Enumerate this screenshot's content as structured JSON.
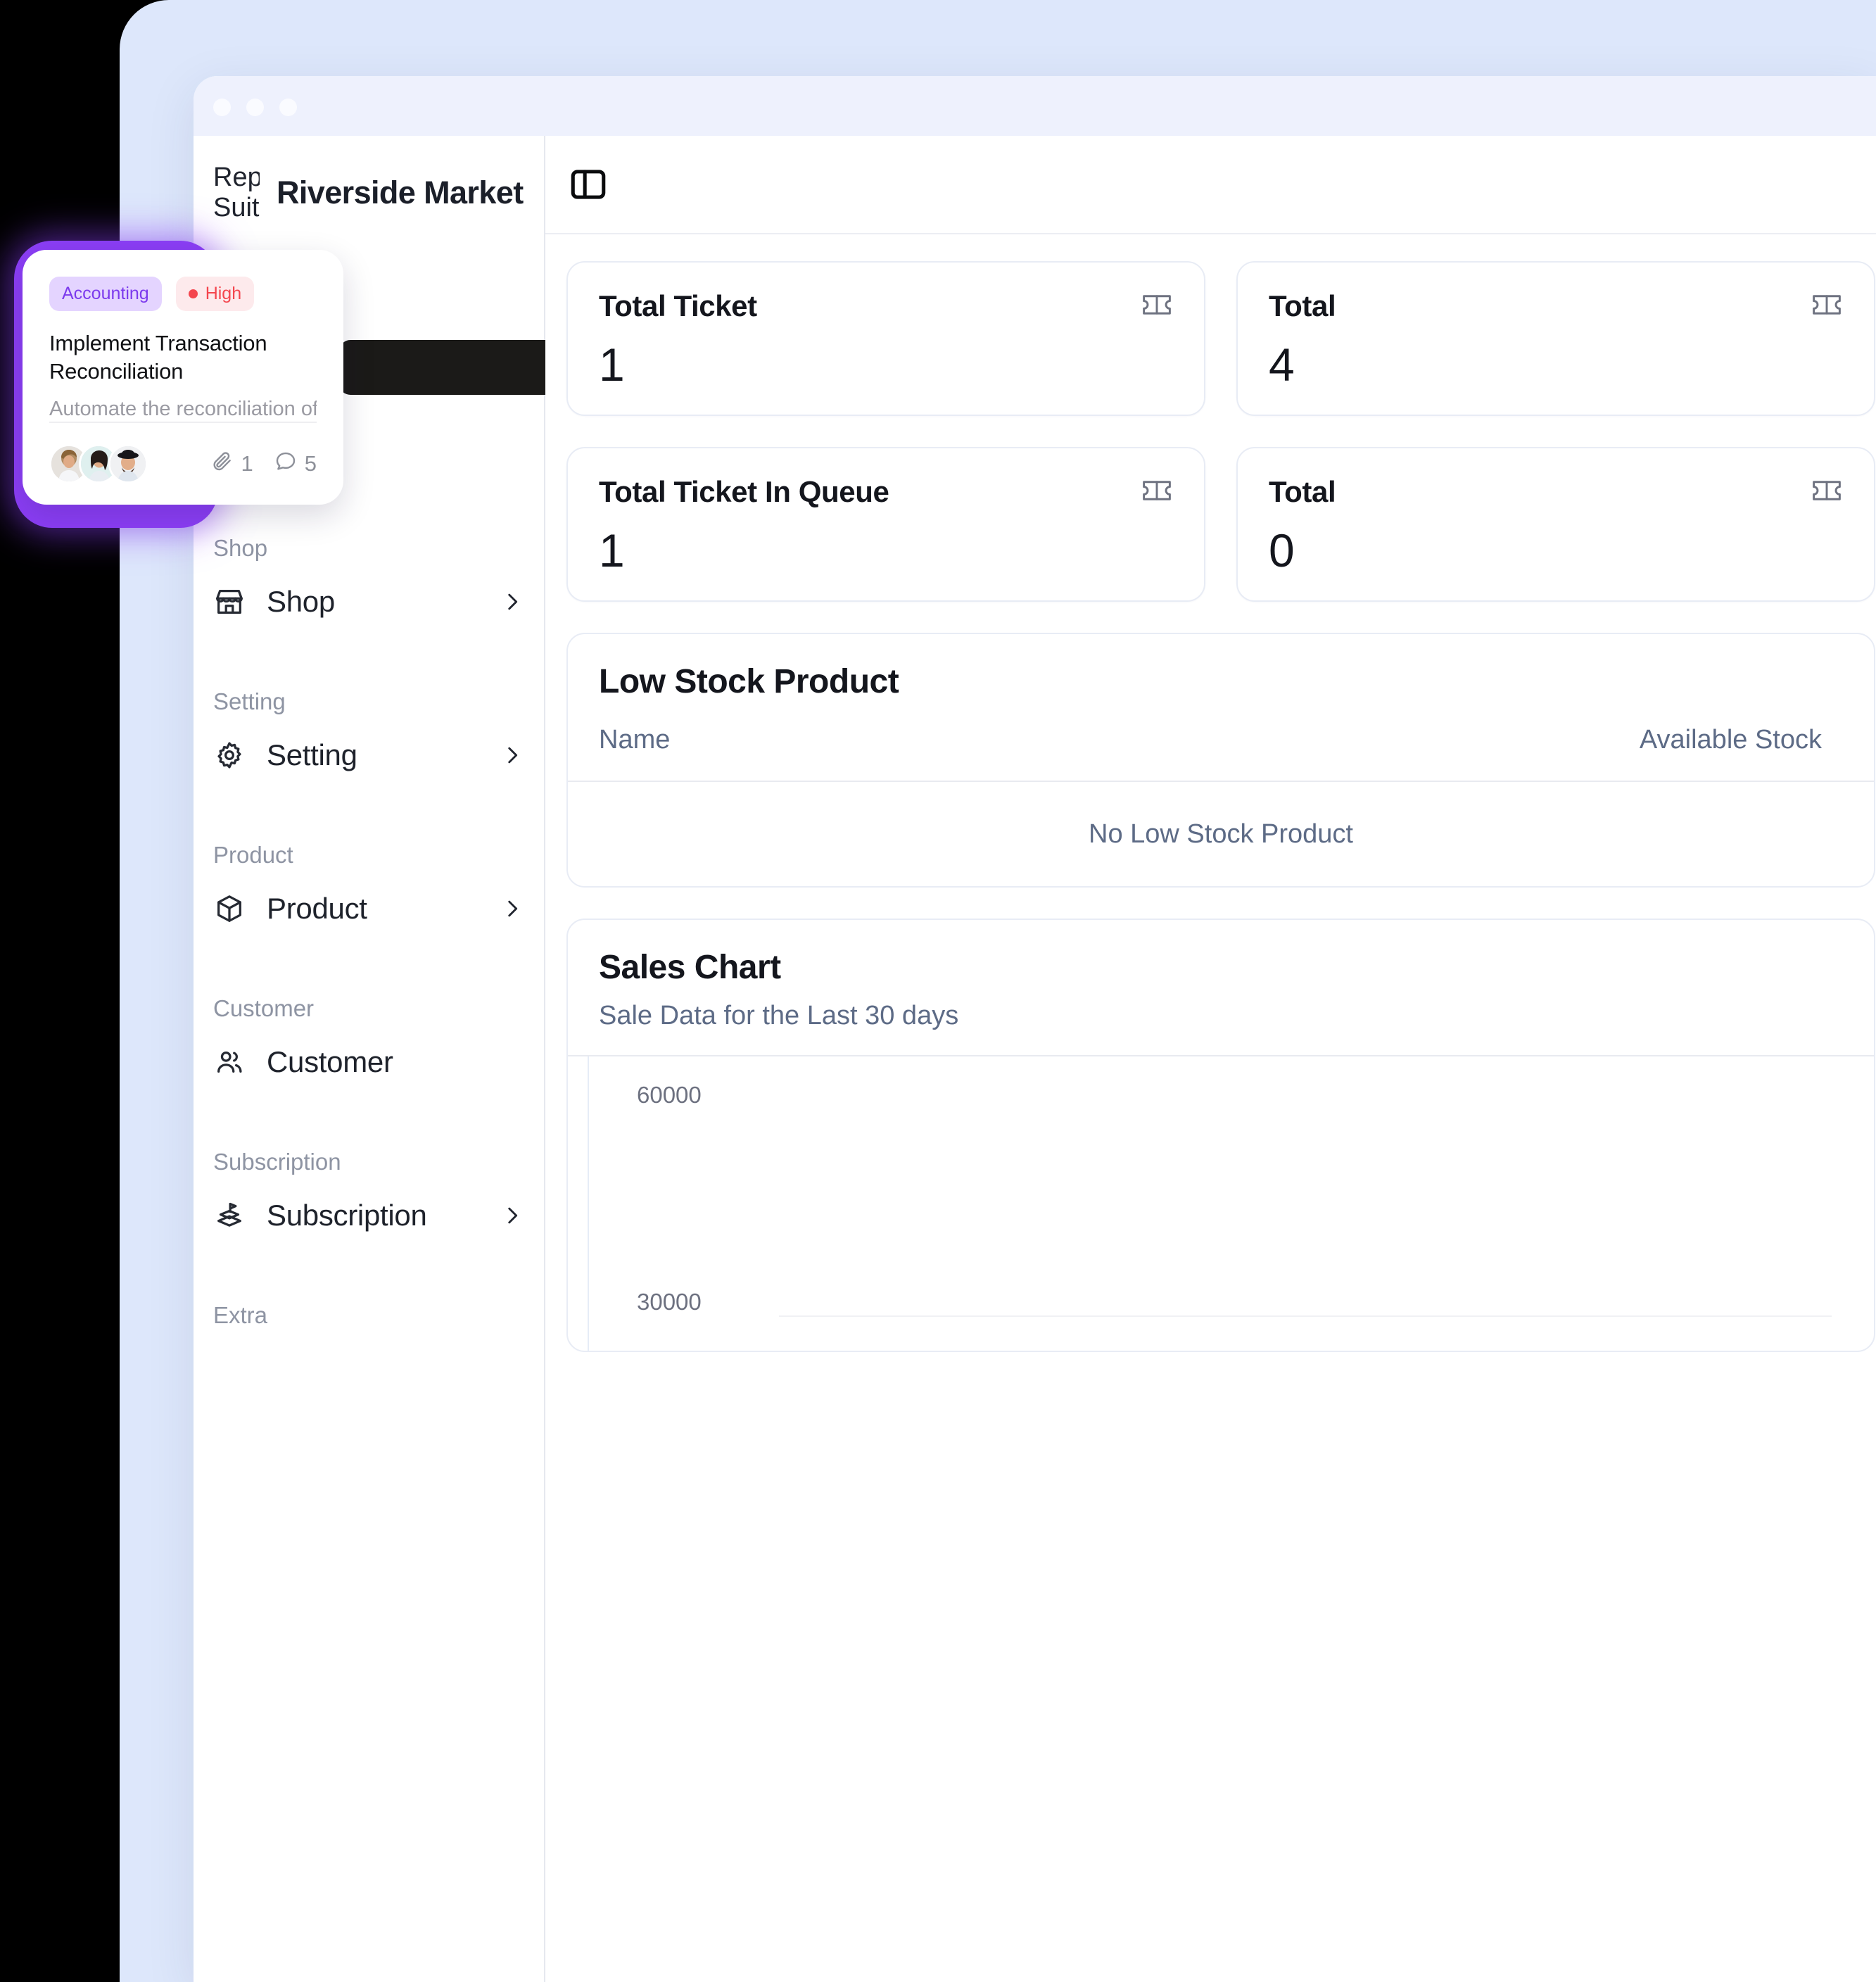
{
  "window": {
    "traffic_lights": [
      "close",
      "minimize",
      "maximize"
    ]
  },
  "sidebar": {
    "brand": "Rep\nSuit",
    "org_name": "Riverside Market",
    "org_switch_icon": "chevron-up-down-icon",
    "groups": [
      {
        "label": "Shop",
        "items": [
          {
            "label": "Shop",
            "icon": "storefront-icon",
            "has_chevron": true
          }
        ]
      },
      {
        "label": "Setting",
        "items": [
          {
            "label": "Setting",
            "icon": "gear-icon",
            "has_chevron": true
          }
        ]
      },
      {
        "label": "Product",
        "items": [
          {
            "label": "Product",
            "icon": "box-icon",
            "has_chevron": true
          }
        ]
      },
      {
        "label": "Customer",
        "items": [
          {
            "label": "Customer",
            "icon": "users-icon",
            "has_chevron": false
          }
        ]
      },
      {
        "label": "Subscription",
        "items": [
          {
            "label": "Subscription",
            "icon": "subscription-flag-icon",
            "has_chevron": true
          }
        ]
      },
      {
        "label": "Extra",
        "items": []
      }
    ]
  },
  "main": {
    "panel_toggle_icon": "sidebar-toggle-icon",
    "stats": [
      {
        "title": "Total Ticket",
        "value": "1",
        "icon": "ticket-icon"
      },
      {
        "title": "Total",
        "value": "4",
        "icon": "ticket-icon"
      },
      {
        "title": "Total Ticket In Queue",
        "value": "1",
        "icon": "ticket-icon"
      },
      {
        "title": "Total",
        "value": "0",
        "icon": "ticket-icon"
      }
    ],
    "low_stock": {
      "title": "Low Stock Product",
      "columns": [
        "Name",
        "Available Stock"
      ],
      "empty_message": "No Low Stock Product"
    },
    "sales_chart": {
      "title": "Sales Chart",
      "subtitle": "Sale Data for the Last 30 days"
    }
  },
  "task_card": {
    "tags": [
      {
        "label": "Accounting",
        "type": "category"
      },
      {
        "label": "High",
        "type": "priority",
        "dot_color": "#f4464e"
      }
    ],
    "title": "Implement Transaction Reconciliation",
    "description": "Automate the reconciliation of b...",
    "assignee_count": 3,
    "attachment_icon": "paperclip-icon",
    "attachment_count": "1",
    "comment_icon": "comment-icon",
    "comment_count": "5",
    "glow_color": "#8b3ef5"
  },
  "chart_data": {
    "type": "line",
    "title": "Sales Chart",
    "subtitle": "Sale Data for the Last 30 days",
    "xlabel": "",
    "ylabel": "",
    "yticks": [
      60000,
      30000
    ],
    "ylim": [
      0,
      60000
    ],
    "x": [],
    "values": [],
    "grid": true,
    "legend": "none",
    "note": "Chart plot area is cropped off the bottom edge of the screenshot; only the y-axis tick labels 60000 and 30000 are visible."
  }
}
